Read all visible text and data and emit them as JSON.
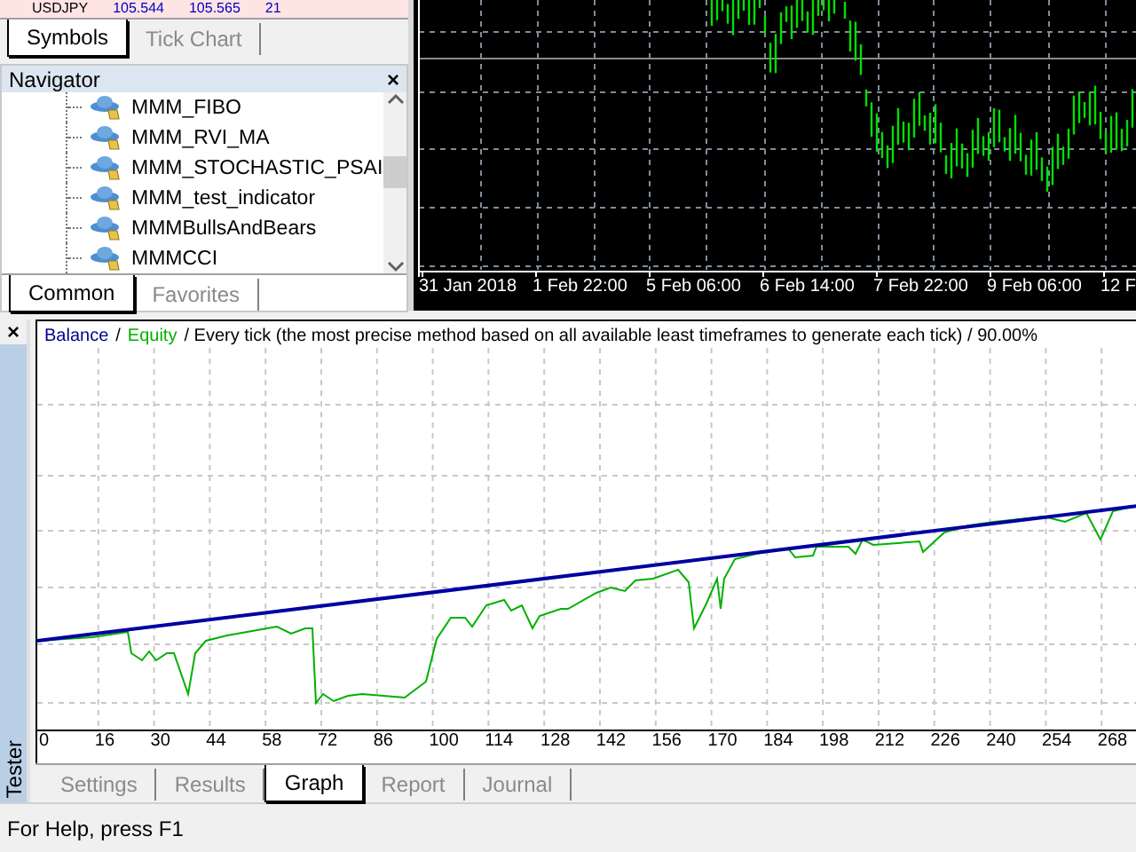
{
  "market_watch": {
    "symbol": "USDJPY",
    "bid": "105.544",
    "ask": "105.565",
    "spread": "21"
  },
  "top_tabs": [
    {
      "label": "Symbols",
      "selected": true
    },
    {
      "label": "Tick Chart",
      "selected": false
    }
  ],
  "navigator": {
    "title": "Navigator",
    "close": "×",
    "items": [
      {
        "label": "MMM_FIBO"
      },
      {
        "label": "MMM_RVI_MA"
      },
      {
        "label": "MMM_STOCHASTIC_PSAI"
      },
      {
        "label": "MMM_test_indicator"
      },
      {
        "label": "MMMBullsAndBears"
      },
      {
        "label": "MMMCCI"
      }
    ],
    "tabs": [
      {
        "label": "Common",
        "selected": true
      },
      {
        "label": "Favorites",
        "selected": false
      }
    ]
  },
  "price_chart": {
    "time_labels": [
      "31 Jan 2018",
      "1 Feb 22:00",
      "5 Feb 06:00",
      "6 Feb 14:00",
      "7 Feb 22:00",
      "9 Feb 06:00",
      "12 F"
    ]
  },
  "tester": {
    "title": "Tester",
    "close": "×",
    "legend": [
      {
        "text": "Balance",
        "color": "#00008b"
      },
      {
        "text": "/",
        "color": "#000000"
      },
      {
        "text": "Equity",
        "color": "#00b000"
      },
      {
        "text": "/ Every tick (the most precise method based on all available least timeframes to generate each tick) / 90.00%",
        "color": "#000000"
      }
    ],
    "x_labels": [
      "0",
      "16",
      "30",
      "44",
      "58",
      "72",
      "86",
      "100",
      "114",
      "128",
      "142",
      "156",
      "170",
      "184",
      "198",
      "212",
      "226",
      "240",
      "254",
      "268"
    ],
    "tabs": [
      {
        "label": "Settings",
        "selected": false
      },
      {
        "label": "Results",
        "selected": false
      },
      {
        "label": "Graph",
        "selected": true
      },
      {
        "label": "Report",
        "selected": false
      },
      {
        "label": "Journal",
        "selected": false
      }
    ]
  },
  "status_bar": {
    "text": "For Help, press F1"
  }
}
